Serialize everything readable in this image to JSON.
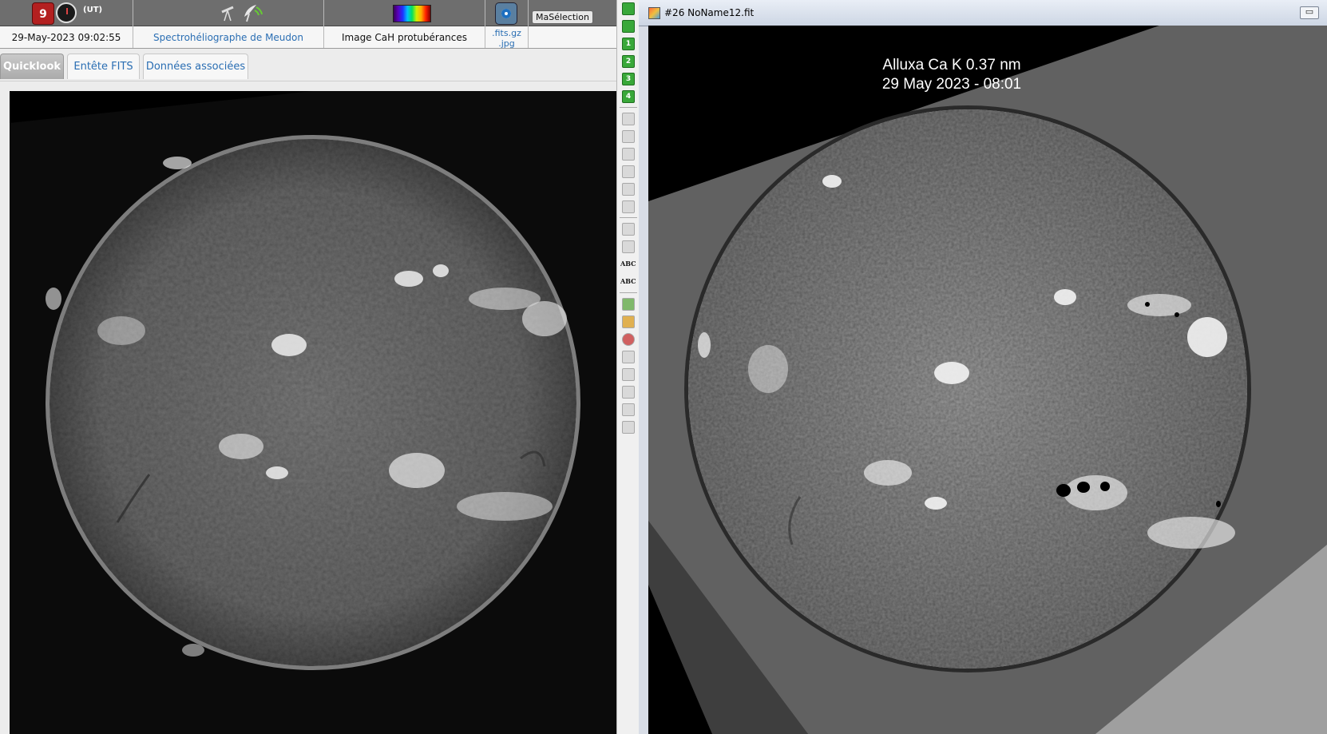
{
  "header": {
    "datetime_label": "(UT)",
    "calendar_day": "9",
    "datetime_value": "29-May-2023 09:02:55",
    "instrument": "Spectrohéliographe de Meudon",
    "image_type": "Image CaH protubérances",
    "download_fits": ".fits.gz",
    "download_jpg": ".jpg",
    "selection_button": "MaSélection"
  },
  "tabs": [
    {
      "label": "Quicklook",
      "active": true
    },
    {
      "label": "Entête FITS",
      "active": false
    },
    {
      "label": "Données associées",
      "active": false
    }
  ],
  "toolbar": {
    "numbered": [
      "1",
      "2",
      "3",
      "4"
    ],
    "text_tools": [
      "ABC",
      "ABC"
    ]
  },
  "fit_window": {
    "title": "#26 NoName12.fit",
    "restore_button": "▭",
    "caption_line1": "Alluxa Ca K 0.37 nm",
    "caption_line2": "29 May 2023 - 08:01"
  },
  "colors": {
    "accent_link": "#2a6eb3",
    "tool_green": "#39a839"
  }
}
